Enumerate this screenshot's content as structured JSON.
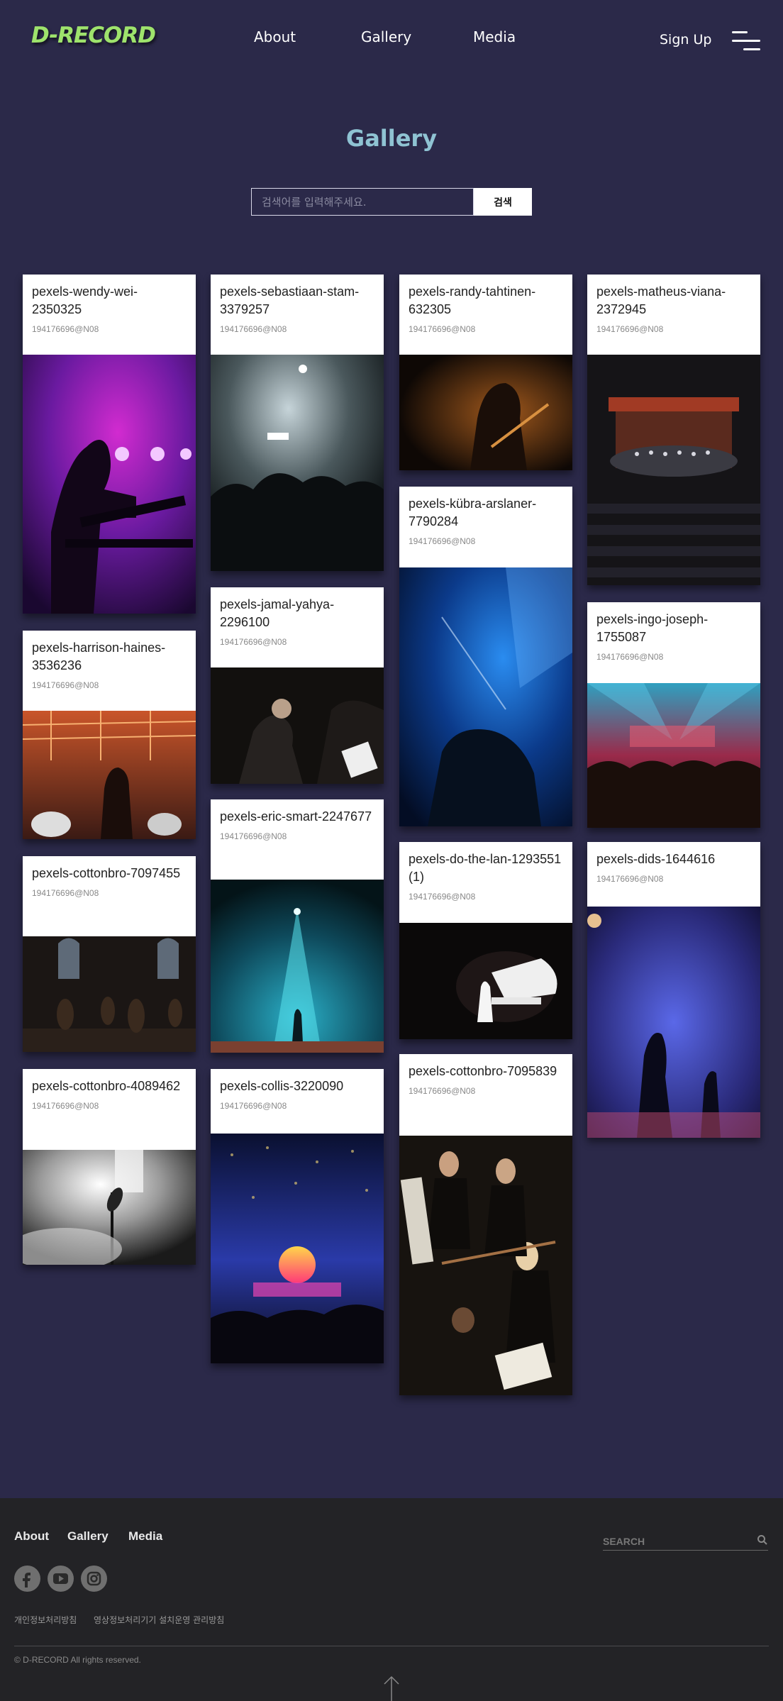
{
  "brand": {
    "logo": "D-RECORD",
    "accent": "#9ee36c"
  },
  "nav": {
    "items": [
      "About",
      "Gallery",
      "Media"
    ],
    "signup": "Sign Up"
  },
  "page": {
    "title": "Gallery"
  },
  "search": {
    "placeholder": "검색어를 입력해주세요.",
    "button": "검색"
  },
  "gallery": {
    "owner": "194176696@N08",
    "cards": [
      {
        "title": "pexels-wendy-wei-2350325",
        "image": "concert-keyboard-purple"
      },
      {
        "title": "pexels-sebastiaan-stam-3379257",
        "image": "concert-crowd-stage"
      },
      {
        "title": "pexels-randy-tahtinen-632305",
        "image": "guitarist-dark"
      },
      {
        "title": "pexels-matheus-viana-2372945",
        "image": "orchestra-theater"
      },
      {
        "title": "pexels-harrison-haines-3536236",
        "image": "band-studio"
      },
      {
        "title": "pexels-jamal-yahya-2296100",
        "image": "conductor-orchestra"
      },
      {
        "title": "pexels-kübra-arslaner-7790284",
        "image": "performer-blue-light"
      },
      {
        "title": "pexels-ingo-joseph-1755087",
        "image": "concert-stage-crowd"
      },
      {
        "title": "pexels-cottonbro-7097455",
        "image": "string-ensemble"
      },
      {
        "title": "pexels-eric-smart-2247677",
        "image": "spotlight-stage"
      },
      {
        "title": "pexels-do-the-lan-1293551 (1)",
        "image": "grand-piano"
      },
      {
        "title": "pexels-dids-1644616",
        "image": "guitarists-stage"
      },
      {
        "title": "pexels-cottonbro-4089462",
        "image": "microphone-smoke"
      },
      {
        "title": "pexels-collis-3220090",
        "image": "festival-confetti"
      },
      {
        "title": "pexels-cottonbro-7095839",
        "image": "violin-quartet"
      }
    ]
  },
  "footer": {
    "nav": [
      "About",
      "Gallery",
      "Media"
    ],
    "search_label": "SEARCH",
    "social": [
      "facebook-icon",
      "youtube-icon",
      "instagram-icon"
    ],
    "links": [
      "개인정보처리방침",
      "영상정보처리기기 설치운영 관리방침"
    ],
    "copyright": "© D-RECORD All rights reserved."
  }
}
